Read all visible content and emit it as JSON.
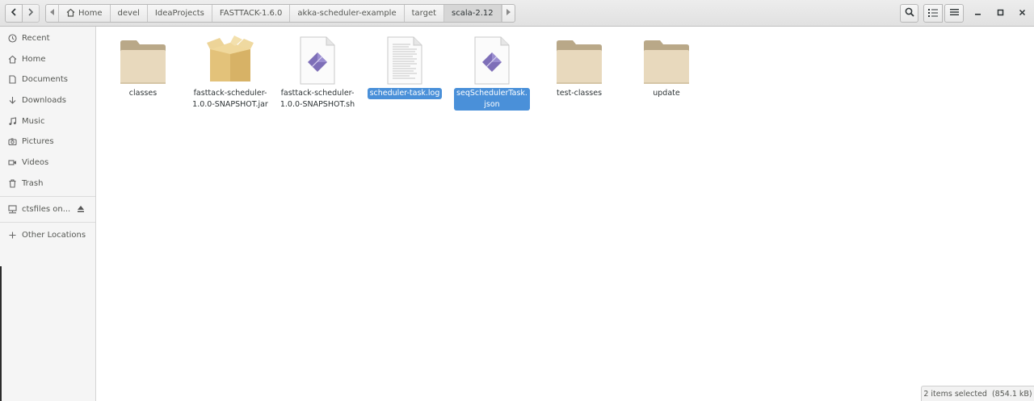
{
  "header": {
    "breadcrumbs": [
      {
        "label": "Home",
        "icon": "home-icon"
      },
      {
        "label": "devel"
      },
      {
        "label": "IdeaProjects"
      },
      {
        "label": "FASTTACK-1.6.0"
      },
      {
        "label": "akka-scheduler-example"
      },
      {
        "label": "target"
      },
      {
        "label": "scala-2.12",
        "active": true
      }
    ]
  },
  "sidebar": {
    "items": [
      {
        "label": "Recent",
        "icon": "clock-icon"
      },
      {
        "label": "Home",
        "icon": "home-icon"
      },
      {
        "label": "Documents",
        "icon": "document-icon"
      },
      {
        "label": "Downloads",
        "icon": "download-icon"
      },
      {
        "label": "Music",
        "icon": "music-icon"
      },
      {
        "label": "Pictures",
        "icon": "camera-icon"
      },
      {
        "label": "Videos",
        "icon": "video-icon"
      },
      {
        "label": "Trash",
        "icon": "trash-icon"
      },
      {
        "label": "ctsfiles on...",
        "icon": "network-drive-icon"
      },
      {
        "label": "Other Locations",
        "icon": "plus-icon"
      }
    ]
  },
  "files": [
    {
      "name": "classes",
      "type": "folder"
    },
    {
      "name": "fasttack-scheduler-\n1.0.0-SNAPSHOT.jar",
      "type": "archive"
    },
    {
      "name": "fasttack-scheduler-\n1.0.0-SNAPSHOT.sh",
      "type": "script"
    },
    {
      "name": "scheduler-task.log",
      "type": "text",
      "selected": true
    },
    {
      "name": "seqSchedulerTask.\njson",
      "type": "script",
      "selected": true
    },
    {
      "name": "test-classes",
      "type": "folder"
    },
    {
      "name": "update",
      "type": "folder"
    }
  ],
  "status": {
    "text": "2 items selected  (854.1 kB)"
  },
  "colors": {
    "selection": "#4a90d9",
    "folder": "#e8d9bd",
    "folder_tab": "#b9a888"
  }
}
